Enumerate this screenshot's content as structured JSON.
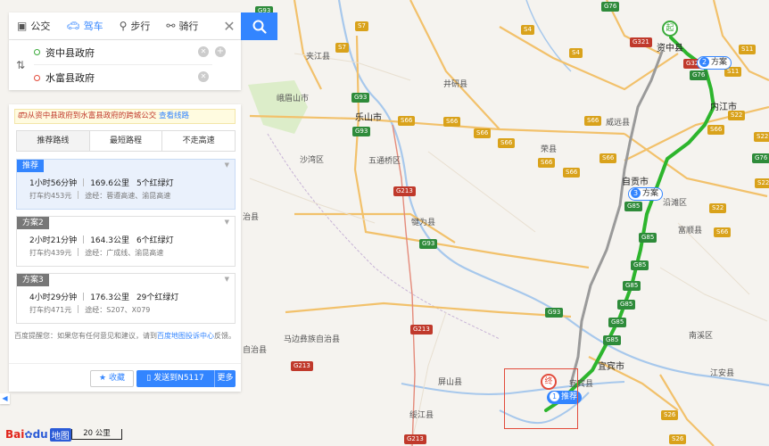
{
  "mode_tabs": [
    {
      "label": "公交",
      "icon": "bus-icon"
    },
    {
      "label": "驾车",
      "icon": "car-icon"
    },
    {
      "label": "步行",
      "icon": "walk-icon"
    },
    {
      "label": "骑行",
      "icon": "bike-icon"
    }
  ],
  "active_mode": "驾车",
  "close_label": "✕",
  "route": {
    "origin": "资中县政府",
    "destination": "水富县政府",
    "swap_label": "⇅"
  },
  "bus_hint": {
    "text": "从资中县政府到水富县政府的跨城公交",
    "link": "查看线路"
  },
  "strategy_tabs": [
    "推荐路线",
    "最短路程",
    "不走高速"
  ],
  "active_strategy": "推荐路线",
  "plans": [
    {
      "tag": "推荐",
      "time": "1小时56分钟",
      "distance": "169.6公里",
      "lights": "5个红绿灯",
      "taxi": "打车约453元",
      "via": "途经：蓉遵高速、渝昆高速"
    },
    {
      "tag": "方案2",
      "time": "2小时21分钟",
      "distance": "164.3公里",
      "lights": "6个红绿灯",
      "taxi": "打车约439元",
      "via": "途经：广成线、渝昆高速"
    },
    {
      "tag": "方案3",
      "time": "4小时29分钟",
      "distance": "176.3公里",
      "lights": "29个红绿灯",
      "taxi": "打车约471元",
      "via": "途经：S207、X079"
    }
  ],
  "tip": {
    "prefix": "百度提醒您：如果您有任何意见和建议，请到",
    "link": "百度地图投诉中心",
    "suffix": "反馈。"
  },
  "actions": {
    "favorite": "收藏",
    "send": "发送到N5117",
    "more": "更多"
  },
  "collapse_label": "◀",
  "logo": {
    "bai": "Bai",
    "du": "du",
    "map": "地图"
  },
  "scale_label": "20 公里",
  "map": {
    "cities": [
      {
        "name": "资中县"
      },
      {
        "name": "内江市"
      },
      {
        "name": "乐山市"
      },
      {
        "name": "自贡市"
      },
      {
        "name": "宜宾市"
      }
    ],
    "places": [
      "夹江县",
      "峨眉山市",
      "井研县",
      "威远县",
      "荣县",
      "沙湾区",
      "五通桥区",
      "犍为县",
      "沿滩区",
      "富顺县",
      "南溪区",
      "江安县",
      "屏山县",
      "绥江县",
      "马边彝族自治县",
      "宜宾县",
      "治县",
      "自治县"
    ],
    "shields_green": [
      "G93",
      "G76",
      "G76",
      "G93",
      "G93",
      "G93",
      "G85",
      "G85",
      "G85",
      "G85",
      "G85",
      "G85",
      "G93",
      "G85",
      "G76"
    ],
    "shields_yellow": [
      "S7",
      "S7",
      "S4",
      "S4",
      "S66",
      "S66",
      "S66",
      "S66",
      "S66",
      "S66",
      "S11",
      "S11",
      "S22",
      "S22",
      "S22",
      "S22",
      "S26",
      "S26",
      "S66",
      "S66",
      "S66",
      "S66"
    ],
    "shields_red": [
      "G321",
      "G213",
      "G213",
      "G213",
      "G213",
      "G321"
    ],
    "tags": [
      {
        "num": "2",
        "label": "方案"
      },
      {
        "num": "3",
        "label": "方案"
      },
      {
        "num": "1",
        "label": "推荐"
      }
    ],
    "start_label": "起",
    "end_label": "终"
  },
  "colors": {
    "accent": "#3385ff",
    "route": "#2db52d",
    "alt_route": "#888888",
    "start": "#3cab3c",
    "end": "#e24b3b"
  }
}
